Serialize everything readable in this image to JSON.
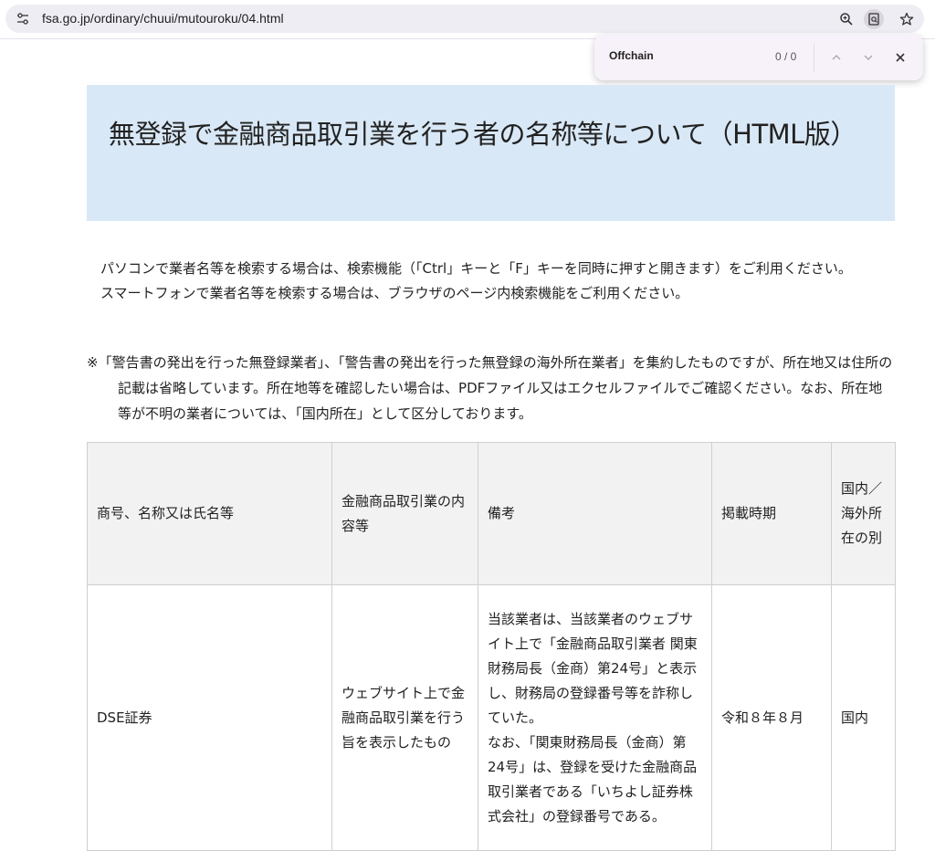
{
  "browser": {
    "url": "fsa.go.jp/ordinary/chuui/mutouroku/04.html",
    "find": {
      "query": "Offchain",
      "count": "0 / 0"
    }
  },
  "page": {
    "title": "無登録で金融商品取引業を行う者の名称等について（HTML版）",
    "intro_1": "パソコンで業者名等を検索する場合は、検索機能（「Ctrl」キーと「F」キーを同時に押すと開きます）をご利用ください。",
    "intro_2": "スマートフォンで業者名等を検索する場合は、ブラウザのページ内検索機能をご利用ください。",
    "note": "※「警告書の発出を行った無登録業者」、「警告書の発出を行った無登録の海外所在業者」を集約したものですが、所在地又は住所の記載は省略しています。所在地等を確認したい場合は、PDFファイル又はエクセルファイルでご確認ください。なお、所在地等が不明の業者については、「国内所在」として区分しております。"
  },
  "table": {
    "headers": [
      "商号、名称又は氏名等",
      "金融商品取引業の内容等",
      "備考",
      "掲載時期",
      "国内／海外所在の別"
    ],
    "rows": [
      {
        "name": "DSE証券",
        "business": "ウェブサイト上で金融商品取引業を行う旨を表示したもの",
        "remarks_1": "当該業者は、当該業者のウェブサイト上で「金融商品取引業者 関東財務局長（金商）第24号」と表示し、財務局の登録番号等を詐称していた。",
        "remarks_2": "なお、「関東財務局長（金商）第24号」は、登録を受けた金融商品取引業者である「いちよし証券株式会社」の登録番号である。",
        "period": "令和８年８月",
        "location": "国内"
      }
    ]
  },
  "icons": {
    "site_info": "tune-icon",
    "zoom": "zoom-in-icon",
    "page_search": "find-in-page-icon",
    "bookmark": "star-icon",
    "find_prev": "chevron-up-icon",
    "find_next": "chevron-down-icon",
    "find_close": "close-icon"
  }
}
